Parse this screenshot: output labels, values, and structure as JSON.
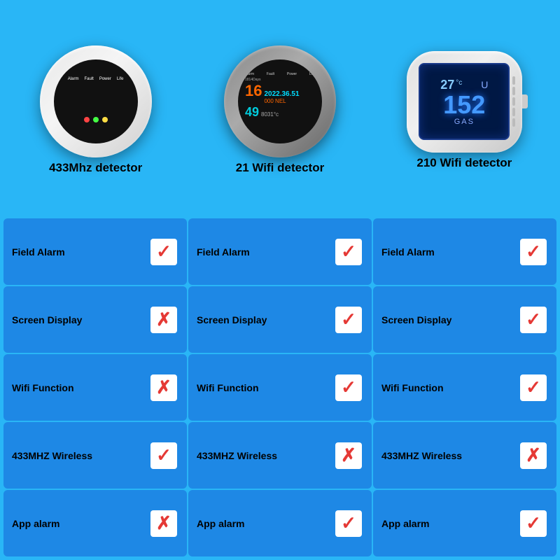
{
  "background_color": "#29b6f6",
  "products": [
    {
      "id": "product1",
      "name": "433Mhz detector",
      "type": "433mhz"
    },
    {
      "id": "product2",
      "name": "21 Wifi detector",
      "type": "wifi21"
    },
    {
      "id": "product3",
      "name": "210 Wifi detector",
      "type": "wifi210"
    }
  ],
  "features": [
    {
      "label": "Field Alarm",
      "values": [
        "yes",
        "yes",
        "yes"
      ]
    },
    {
      "label": "Screen Display",
      "values": [
        "no",
        "yes",
        "yes"
      ]
    },
    {
      "label": "Wifi Function",
      "values": [
        "no",
        "yes",
        "yes"
      ]
    },
    {
      "label": "433MHZ Wireless",
      "values": [
        "yes",
        "no",
        "no"
      ]
    },
    {
      "label": "App alarm",
      "values": [
        "no",
        "yes",
        "yes"
      ]
    }
  ]
}
